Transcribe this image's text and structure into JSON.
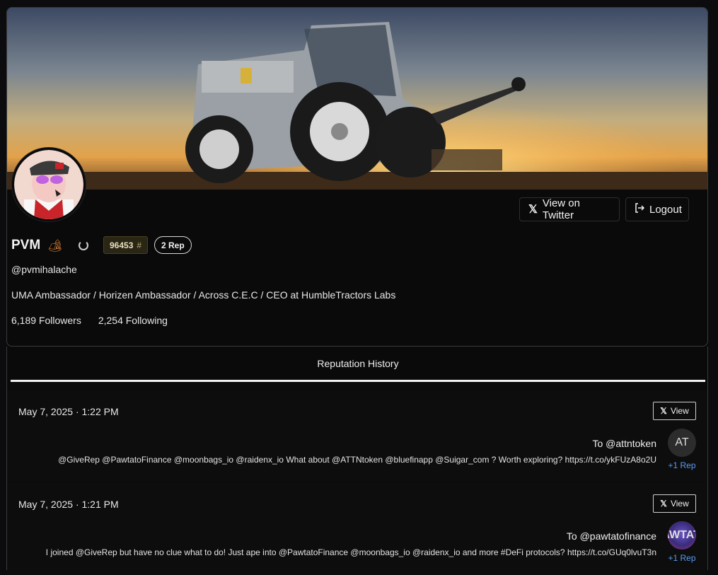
{
  "profile": {
    "name": "PVM",
    "name_icon": "🏕",
    "rank": "96453",
    "rank_suffix": "#",
    "rep": "2 Rep",
    "handle": "@pvmihalache",
    "bio": "UMA Ambassador / Horizen Ambassador / Across C.E.C / CEO at HumbleTractors Labs",
    "followers": "6,189 Followers",
    "following": "2,254 Following"
  },
  "actions": {
    "twitter_label": "View on Twitter",
    "logout_label": "Logout"
  },
  "tabs": {
    "active": "Reputation History"
  },
  "history": [
    {
      "date": "May 7, 2025 · 1:22 PM",
      "view_label": "View",
      "to": "To @attntoken",
      "avatar_text": "AT",
      "message": "@GiveRep @PawtatoFinance @moonbags_io @raidenx_io What about @ATTNtoken @bluefinapp @Suigar_com ? Worth exploring? https://t.co/ykFUzA8o2U",
      "rep": "+1 Rep"
    },
    {
      "date": "May 7, 2025 · 1:21 PM",
      "view_label": "View",
      "to": "To @pawtatofinance",
      "avatar_text": "PAWTATO",
      "message": "I joined @GiveRep but have no clue what to do! Just ape into @PawtatoFinance @moonbags_io @raidenx_io and more #DeFi protocols? https://t.co/GUq0lvuT3n",
      "rep": "+1 Rep"
    }
  ],
  "colors": {
    "background": "#0c0c0e",
    "rep_link": "#5b9bf0",
    "rank_badge_bg": "#2a2616"
  }
}
